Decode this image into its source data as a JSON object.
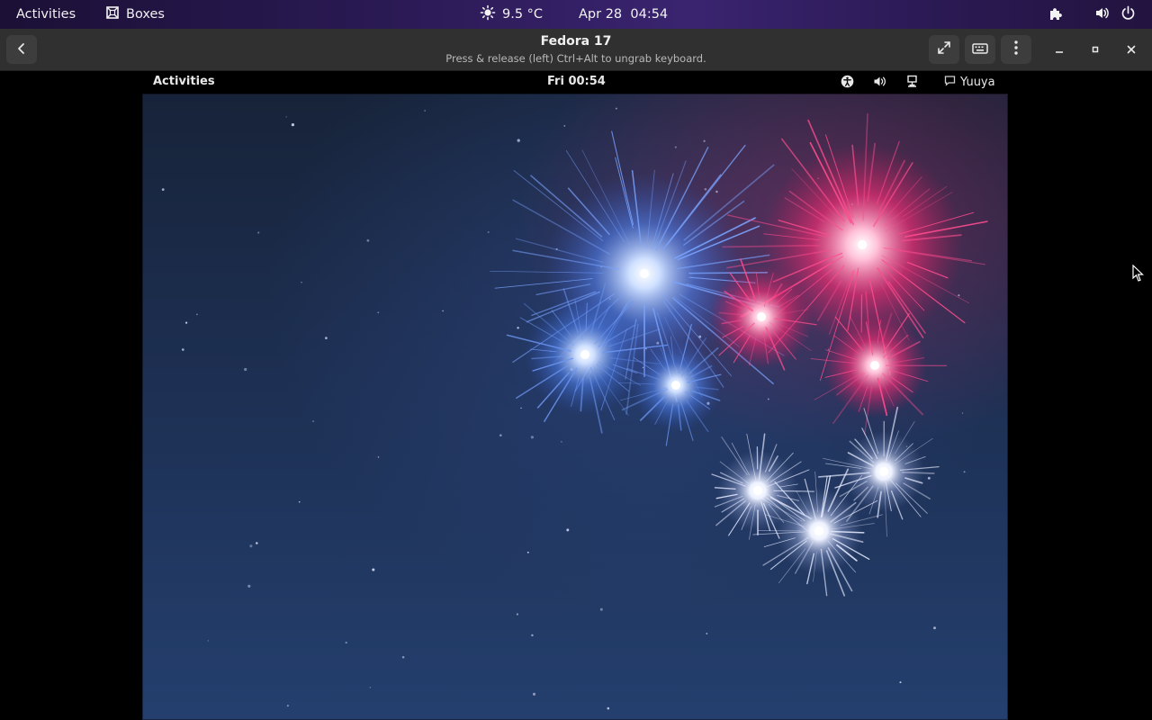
{
  "host_topbar": {
    "activities": "Activities",
    "app_name": "Boxes",
    "weather": "9.5 °C",
    "datetime": "Apr 28  04:54"
  },
  "headerbar": {
    "title": "Fedora 17",
    "subtitle": "Press & release (left) Ctrl+Alt to ungrab keyboard."
  },
  "guest_panel": {
    "activities": "Activities",
    "clock": "Fri 00:54",
    "user": "Yuuya"
  },
  "colors": {
    "host_bar_accent": "#3a2470",
    "headerbar_bg": "#303030",
    "firework_blue": "#6f9bff",
    "firework_pink": "#ff3d84",
    "firework_white": "#e8ecff"
  },
  "icons": [
    "boxes-icon",
    "sun-icon",
    "extensions-icon",
    "volume-icon",
    "power-icon",
    "back-icon",
    "fullscreen-icon",
    "keyboard-icon",
    "menu-icon",
    "minimize-icon",
    "maximize-icon",
    "close-icon",
    "accessibility-icon",
    "guest-volume-icon",
    "network-icon",
    "chat-icon",
    "mouse-cursor"
  ]
}
